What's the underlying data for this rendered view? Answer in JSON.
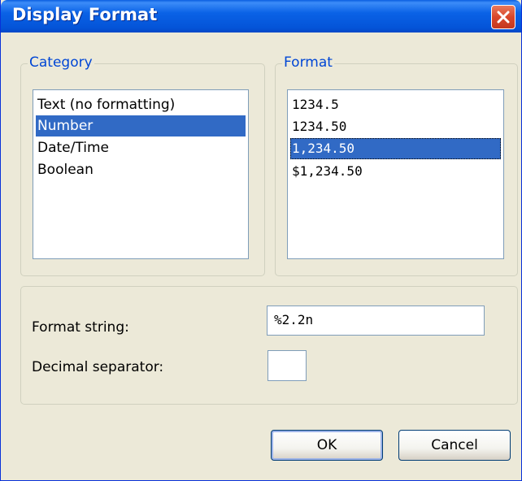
{
  "window": {
    "title": "Display Format"
  },
  "category": {
    "legend": "Category",
    "items": [
      {
        "label": "Text (no formatting)",
        "selected": false
      },
      {
        "label": "Number",
        "selected": true
      },
      {
        "label": "Date/Time",
        "selected": false
      },
      {
        "label": "Boolean",
        "selected": false
      }
    ]
  },
  "format": {
    "legend": "Format",
    "items": [
      {
        "label": "1234.5",
        "selected": false
      },
      {
        "label": "1234.50",
        "selected": false
      },
      {
        "label": "1,234.50",
        "selected": true
      },
      {
        "label": "$1,234.50",
        "selected": false
      }
    ]
  },
  "options": {
    "format_string_label": "Format string:",
    "format_string_value": "%2.2n",
    "decimal_separator_label": "Decimal separator:",
    "decimal_separator_value": ""
  },
  "buttons": {
    "ok": "OK",
    "cancel": "Cancel"
  },
  "colors": {
    "selection": "#316ac5",
    "legend_text": "#0046d5",
    "titlebar": "#0454d8"
  },
  "icons": {
    "close": "close-icon"
  }
}
